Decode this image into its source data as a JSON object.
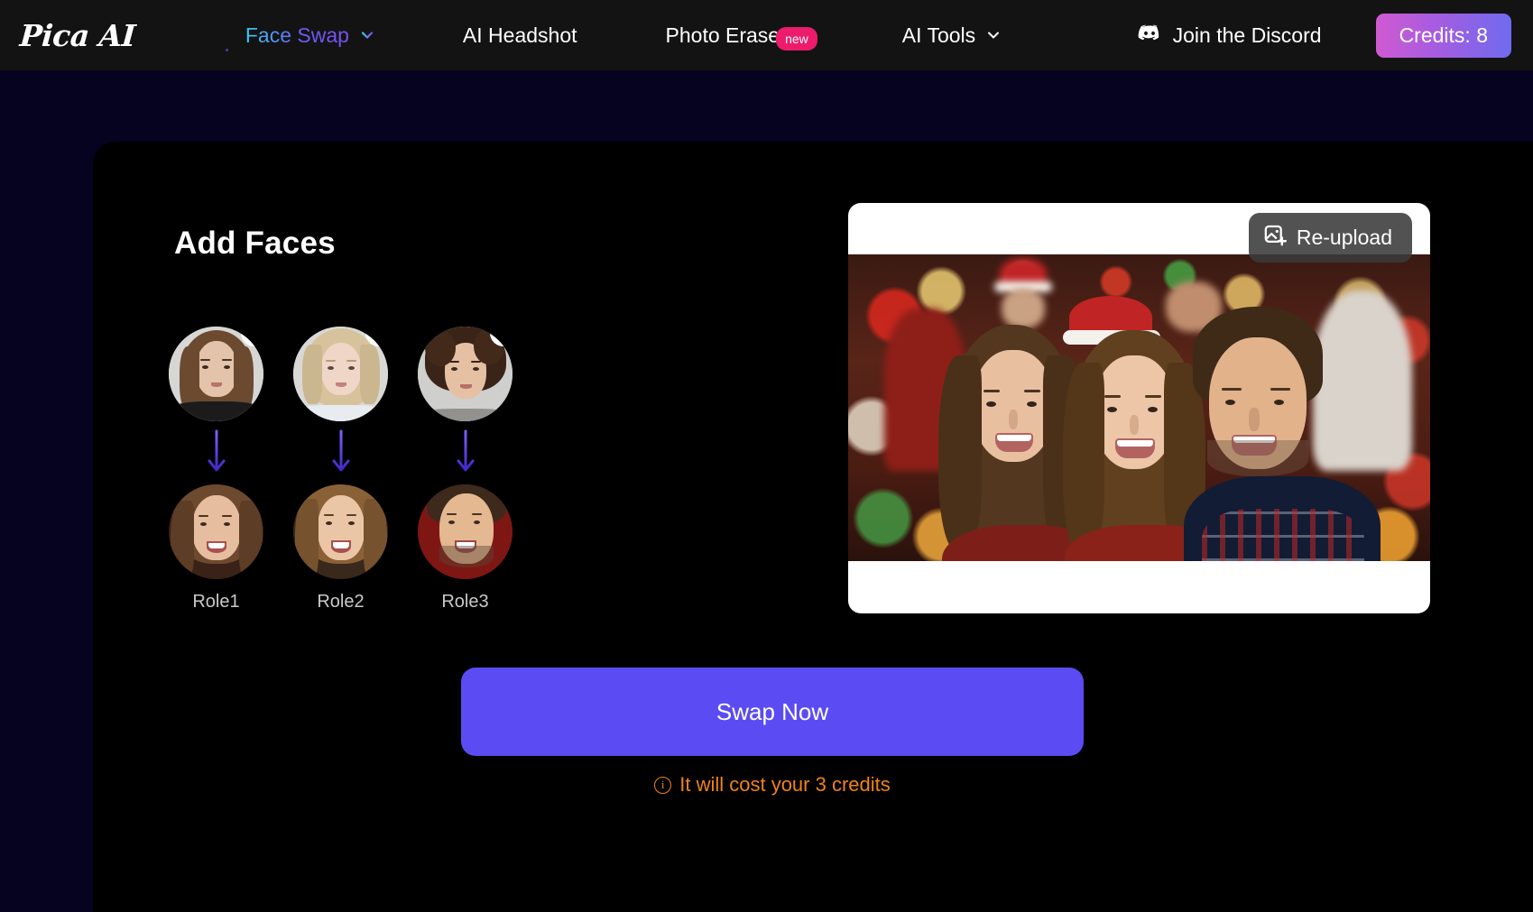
{
  "header": {
    "logo": "Pica AI",
    "nav": [
      {
        "label": "Face Swap",
        "icon": "chevron-down-icon",
        "active": true,
        "badge": null
      },
      {
        "label": "AI Headshot",
        "icon": null,
        "active": false,
        "badge": null
      },
      {
        "label": "Photo Eraser",
        "icon": null,
        "active": false,
        "badge": "new"
      },
      {
        "label": "AI Tools",
        "icon": "chevron-down-icon",
        "active": false,
        "badge": null
      }
    ],
    "discord_label": "Join the Discord",
    "discord_icon": "discord-icon",
    "credits_label": "Credits: 8"
  },
  "main": {
    "title": "Add Faces",
    "pairs": [
      {
        "role": "Role1",
        "source_face": "source-face-1",
        "target_face": "target-face-1",
        "edit_icon": "pencil-icon",
        "arrow_icon": "arrow-down-icon"
      },
      {
        "role": "Role2",
        "source_face": "source-face-2",
        "target_face": "target-face-2",
        "edit_icon": "pencil-icon",
        "arrow_icon": "arrow-down-icon"
      },
      {
        "role": "Role3",
        "source_face": "source-face-3",
        "target_face": "target-face-3",
        "edit_icon": "pencil-icon",
        "arrow_icon": "arrow-down-icon"
      }
    ],
    "swap_button": "Swap Now",
    "cost_note": "It will cost your 3 credits",
    "cost_icon": "info-icon"
  },
  "preview": {
    "reupload_label": "Re-upload",
    "reupload_icon": "image-add-icon",
    "image_alt": "group-photo-christmas"
  },
  "colors": {
    "accent_purple": "#5b4bf2",
    "badge_pink": "#ec1b6b",
    "warning_orange": "#f08318",
    "page_bg": "#05031f",
    "card_bg": "#000000",
    "header_bg": "#131313"
  }
}
